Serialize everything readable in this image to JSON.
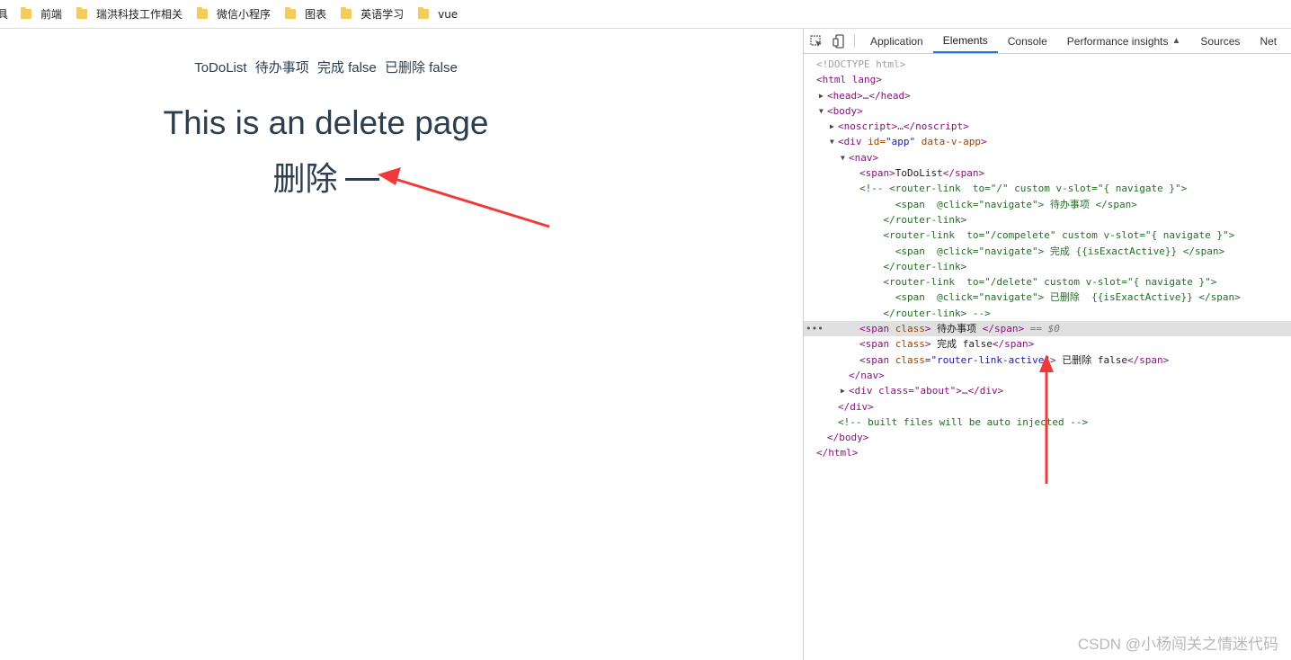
{
  "bookmarks": {
    "cut_text": "具",
    "items": [
      "前端",
      "瑞洪科技工作相关",
      "微信小程序",
      "图表",
      "英语学习",
      "vue"
    ]
  },
  "page": {
    "nav": [
      "ToDoList",
      "待办事项",
      "完成 false",
      "已删除 false"
    ],
    "heading": "This is an delete page",
    "subheading": "删除"
  },
  "devtools": {
    "tabs": [
      "Application",
      "Elements",
      "Console",
      "Performance insights",
      "Sources",
      "Net"
    ],
    "active_tab": "Elements",
    "code": {
      "doctype": "<!DOCTYPE html>",
      "html_open": "<html lang>",
      "head": "<head>…</head>",
      "body_open": "<body>",
      "noscript": "<noscript>…</noscript>",
      "div_open_tag": "<div ",
      "div_id_attr": "id=",
      "div_id_val": "\"app\"",
      "div_data_attr": " data-v-app",
      "nav_open": "<nav>",
      "span_open": "<span>",
      "span_todolist": "ToDoList",
      "span_close": "</span>",
      "comment_lines": [
        "<!-- <router-link  to=\"/\" custom v-slot=\"{ navigate }\">",
        "      <span  @click=\"navigate\"> 待办事项 </span>",
        "    </router-link>",
        "    <router-link  to=\"/compelete\" custom v-slot=\"{ navigate }\">",
        "      <span  @click=\"navigate\"> 完成 {{isExactActive}} </span>",
        "    </router-link>",
        "    <router-link  to=\"/delete\" custom v-slot=\"{ navigate }\">",
        "      <span  @click=\"navigate\"> 已删除  {{isExactActive}} </span>",
        "    </router-link> -->"
      ],
      "span_class_open": "<span ",
      "class_attr": "class",
      "sel_text": " 待办事项 ",
      "sel_suffix": "== $0",
      "done_text": " 完成 false",
      "active_class_val": "\"router-link-active\"",
      "deleted_text": " 已删除 false",
      "nav_close": "</nav>",
      "about_div": "<div class=\"about\">…</div>",
      "div_close": "</div>",
      "built_comment": "<!-- built files will be auto injected -->",
      "body_close": "</body>",
      "html_close": "</html>"
    }
  },
  "watermark": "CSDN @小杨闯关之情迷代码",
  "colors": {
    "arrow": "#f03a3a",
    "text": "#2c3e50",
    "tab_active": "#1a73e8"
  }
}
